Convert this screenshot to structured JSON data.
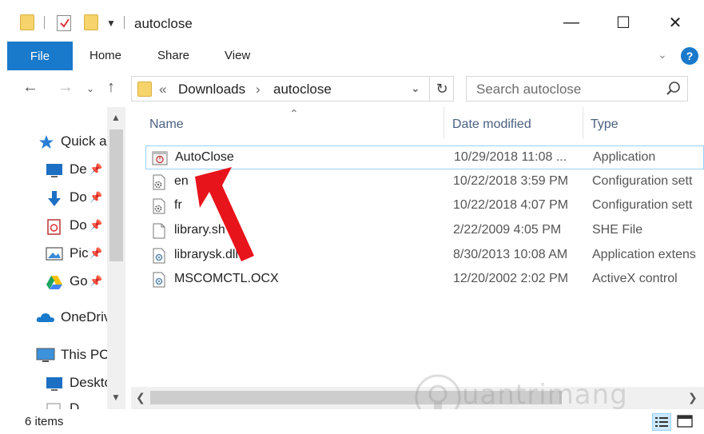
{
  "window": {
    "title": "autoclose",
    "minimize_glyph": "—",
    "maximize_glyph": "☐",
    "close_glyph": "✕"
  },
  "ribbon": {
    "tabs": [
      "File",
      "Home",
      "Share",
      "View"
    ],
    "help_glyph": "?"
  },
  "nav": {
    "breadcrumb_prefix": "«",
    "breadcrumb": [
      "Downloads",
      "autoclose"
    ],
    "breadcrumb_sep": "›",
    "search_placeholder": "Search autoclose"
  },
  "sidebar": {
    "items": [
      {
        "label": "Quick a",
        "icon": "star-icon",
        "pinned": false
      },
      {
        "label": "De",
        "icon": "desktop-icon",
        "pinned": true
      },
      {
        "label": "Do",
        "icon": "downloads-icon",
        "pinned": true
      },
      {
        "label": "Do",
        "icon": "documents-icon",
        "pinned": true
      },
      {
        "label": "Pic",
        "icon": "pictures-icon",
        "pinned": true
      },
      {
        "label": "Go",
        "icon": "google-drive-icon",
        "pinned": true
      },
      {
        "label": "OneDriv",
        "icon": "onedrive-icon",
        "pinned": false
      },
      {
        "label": "This PC",
        "icon": "this-pc-icon",
        "pinned": false
      },
      {
        "label": "Deskto",
        "icon": "desktop-icon",
        "pinned": false
      },
      {
        "label": "D",
        "icon": "folder-icon",
        "pinned": false
      }
    ]
  },
  "columns": {
    "name": "Name",
    "date": "Date modified",
    "type": "Type"
  },
  "files": [
    {
      "name": "AutoClose",
      "date": "10/29/2018 11:08 ...",
      "type": "Application",
      "icon": "application-icon",
      "selected": true
    },
    {
      "name": "en",
      "date": "10/22/2018 3:59 PM",
      "type": "Configuration sett",
      "icon": "config-file-icon",
      "selected": false
    },
    {
      "name": "fr",
      "date": "10/22/2018 4:07 PM",
      "type": "Configuration sett",
      "icon": "config-file-icon",
      "selected": false
    },
    {
      "name": "library.sh",
      "date": "2/22/2009 4:05 PM",
      "type": "SHE File",
      "icon": "file-icon",
      "selected": false
    },
    {
      "name": "librarysk.dll",
      "date": "8/30/2013 10:08 AM",
      "type": "Application extens",
      "icon": "dll-file-icon",
      "selected": false
    },
    {
      "name": "MSCOMCTL.OCX",
      "date": "12/20/2002 2:02 PM",
      "type": "ActiveX control",
      "icon": "ocx-file-icon",
      "selected": false
    }
  ],
  "status": {
    "item_count": "6 items"
  },
  "watermark": {
    "text": "uantrimang"
  },
  "colors": {
    "accent": "#1979ca",
    "selection_border": "#99d1ff",
    "annotation_arrow": "#e8141b"
  }
}
